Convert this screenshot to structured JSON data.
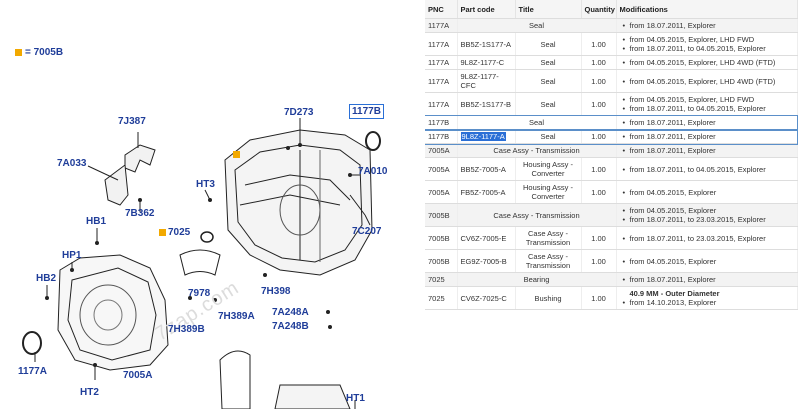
{
  "diagram": {
    "legend": "= 7005B",
    "labels": {
      "7J387": "7J387",
      "7D273": "7D273",
      "1177B": "1177B",
      "7A033": "7A033",
      "HT3": "HT3",
      "7A010": "7A010",
      "7B362": "7B362",
      "HB1": "HB1",
      "7025": "7025",
      "7C207": "7C207",
      "HP1": "HP1",
      "HB2": "HB2",
      "7978": "7978",
      "7H398": "7H398",
      "7H389B": "7H389B",
      "7H389A": "7H389A",
      "7A248A": "7A248A",
      "7A248B": "7A248B",
      "1177A": "1177A",
      "HT2": "HT2",
      "7005A": "7005A",
      "HT1": "HT1"
    },
    "watermark": "7zap.com",
    "colors": {
      "label": "#1f3d99",
      "accent": "#f2a900",
      "highlight_box": "#2a6fd6"
    }
  },
  "table": {
    "headers": [
      "PNC",
      "Part code",
      "Title",
      "Quantity",
      "Modifications"
    ],
    "rows": [
      {
        "type": "group",
        "pnc": "1177A",
        "title": "Seal",
        "mods": [
          "from 18.07.2011, Explorer"
        ]
      },
      {
        "type": "part",
        "pnc": "1177A",
        "code": "BB5Z-1S177-A",
        "title": "Seal",
        "qty": "1.00",
        "mods": [
          "from 04.05.2015, Explorer, LHD FWD",
          "from 18.07.2011, to 04.05.2015, Explorer"
        ]
      },
      {
        "type": "part",
        "pnc": "1177A",
        "code": "9L8Z-1177-C",
        "title": "Seal",
        "qty": "1.00",
        "mods": [
          "from 04.05.2015, Explorer, LHD 4WD (FTD)"
        ]
      },
      {
        "type": "part",
        "pnc": "1177A",
        "code": "9L8Z-1177-CFC",
        "title": "Seal",
        "qty": "1.00",
        "mods": [
          "from 04.05.2015, Explorer, LHD 4WD (FTD)"
        ]
      },
      {
        "type": "part",
        "pnc": "1177A",
        "code": "BB5Z-1S177-B",
        "title": "Seal",
        "qty": "1.00",
        "mods": [
          "from 04.05.2015, Explorer, LHD FWD",
          "from 18.07.2011, to 04.05.2015, Explorer"
        ]
      },
      {
        "type": "group",
        "selected": true,
        "pnc": "1177B",
        "title": "Seal",
        "mods": [
          "from 18.07.2011, Explorer"
        ]
      },
      {
        "type": "part",
        "selected": true,
        "highlight": true,
        "pnc": "1177B",
        "code": "9L8Z-1177-A",
        "title": "Seal",
        "qty": "1.00",
        "mods": [
          "from 18.07.2011, Explorer"
        ]
      },
      {
        "type": "group",
        "pnc": "7005A",
        "title": "Case Assy - Transmission",
        "mods": [
          "from 18.07.2011, Explorer"
        ]
      },
      {
        "type": "part",
        "pnc": "7005A",
        "code": "BB5Z-7005-A",
        "title": "Housing Assy - Converter",
        "qty": "1.00",
        "mods": [
          "from 18.07.2011, to 04.05.2015, Explorer"
        ]
      },
      {
        "type": "part",
        "pnc": "7005A",
        "code": "FB5Z-7005-A",
        "title": "Housing Assy - Converter",
        "qty": "1.00",
        "mods": [
          "from 04.05.2015, Explorer"
        ]
      },
      {
        "type": "group",
        "pnc": "7005B",
        "title": "Case Assy - Transmission",
        "mods": [
          "from 04.05.2015, Explorer",
          "from 18.07.2011, to 23.03.2015, Explorer"
        ]
      },
      {
        "type": "part",
        "pnc": "7005B",
        "code": "CV6Z-7005-E",
        "title": "Case Assy - Transmission",
        "qty": "1.00",
        "mods": [
          "from 18.07.2011, to 23.03.2015, Explorer"
        ]
      },
      {
        "type": "part",
        "pnc": "7005B",
        "code": "EG9Z-7005-B",
        "title": "Case Assy - Transmission",
        "qty": "1.00",
        "mods": [
          "from 04.05.2015, Explorer"
        ]
      },
      {
        "type": "group",
        "pnc": "7025",
        "title": "Bearing",
        "mods": [
          "from 18.07.2011, Explorer"
        ]
      },
      {
        "type": "part",
        "pnc": "7025",
        "code": "CV6Z-7025-C",
        "title": "Bushing",
        "qty": "1.00",
        "mods_bold": "40.9 MM - Outer Diameter",
        "mods": [
          "from 14.10.2013, Explorer"
        ]
      }
    ]
  }
}
